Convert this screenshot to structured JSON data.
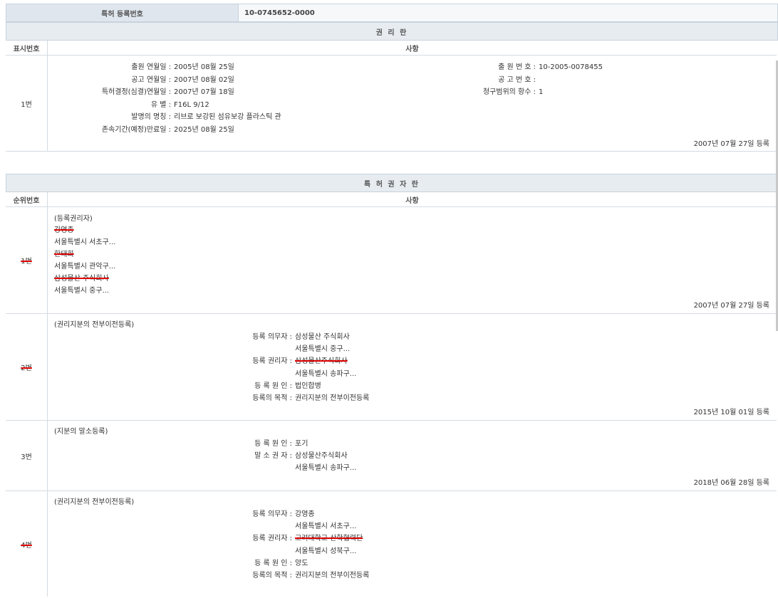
{
  "reg": {
    "label": "특허 등록번호",
    "value": "10-0745652-0000"
  },
  "rights_section": {
    "title": "권 리 란",
    "col_num": "표시번호",
    "col_content": "사항",
    "row": {
      "num": "1번",
      "filing_date_label": "출원 연월일 :",
      "filing_date": "2005년 08월 25일",
      "pub_date_label": "공고 연월일 :",
      "pub_date": "2007년 08월 02일",
      "decision_label": "특허결정(심결)연월일 :",
      "decision_date": "2007년 07월 18일",
      "class_label": "유 별 :",
      "class_value": "F16L 9/12",
      "title_label": "발명의 명칭 :",
      "title_value": "리브로 보강된 섬유보강 플라스틱 관",
      "expiry_label": "존속기간(예정)만료일 :",
      "expiry_date": "2025년 08월 25일",
      "app_no_label": "출 원 번 호 :",
      "app_no": "10-2005-0078455",
      "pub_no_label": "공 고 번 호 :",
      "pub_no": "",
      "claims_label": "청구범위의 항수 :",
      "claims": "1",
      "reg_date": "2007년 07월 27일 등록"
    }
  },
  "holders_section": {
    "title": "특 허 권 자 란",
    "col_num": "순위번호",
    "col_content": "사항",
    "rows": [
      {
        "num": "1번",
        "heading": "(등록권리자)",
        "lines": [
          "강영종",
          "서울특별시 서초구...",
          "한태희",
          "서울특별시 관악구...",
          "삼성물산 주식회사",
          "서울특별시 중구..."
        ],
        "date": "2007년 07월 27일 등록"
      },
      {
        "num": "2번",
        "heading": "(권리지분의 전부이전등록)",
        "f1_label": "등록 의무자 :",
        "f1_value": "삼성물산 주식회사",
        "f1_addr": "서울특별시 중구...",
        "f2_label": "등록 권리자 :",
        "f2_value": "삼성물산주식회사",
        "f2_addr": "서울특별시 송파구...",
        "f3_label": "등 록 원 인 :",
        "f3_value": "법인합병",
        "f4_label": "등록의 목적 :",
        "f4_value": "권리지분의 전부이전등록",
        "date": "2015년 10월 01일 등록"
      },
      {
        "num": "3번",
        "heading": "(지분의 말소등록)",
        "f1_label": "등 록 원 인 :",
        "f1_value": "포기",
        "f2_label": "말 소 권 자 :",
        "f2_value": "삼성물산주식회사",
        "f2_addr": "서울특별시 송파구...",
        "date": "2018년 06월 28일 등록"
      },
      {
        "num": "4번",
        "heading": "(권리지분의 전부이전등록)",
        "f1_label": "등록 의무자 :",
        "f1_value": "강영종",
        "f1_addr": "서울특별시 서초구...",
        "f2_label": "등록 권리자 :",
        "f2_value": "고려대학교 산학협력단",
        "f2_addr": "서울특별시 성북구...",
        "f3_label": "등 록 원 인 :",
        "f3_value": "양도",
        "f4_label": "등록의 목적 :",
        "f4_value": "권리지분의 전부이전등록"
      }
    ]
  }
}
